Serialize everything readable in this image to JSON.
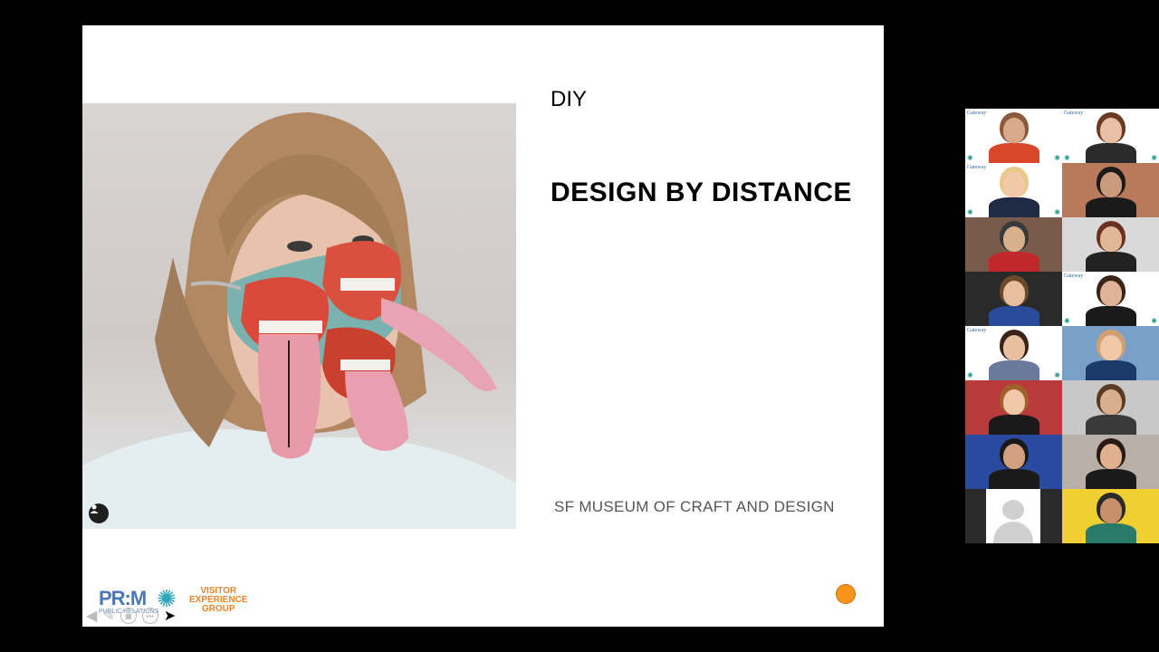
{
  "slide": {
    "heading_small": "DIY",
    "heading_main": "DESIGN BY DISTANCE",
    "credit": "SF MUSEUM OF CRAFT AND DESIGN",
    "logo": {
      "prm": "PR:M",
      "prm_sub": "PUBLIC RELATIONS",
      "veg_line1": "VISITOR",
      "veg_line2": "EXPERIENCE",
      "veg_line3": "GROUP"
    },
    "photo_alt": "person wearing knitted mask with tongues",
    "accent_color": "#f7941d"
  },
  "toolbar": {
    "back_icon": "arrow-left-icon",
    "pen_icon": "pen-icon",
    "slides_icon": "grid-icon",
    "more_icon": "more-icon",
    "pointer_icon": "pointer-icon"
  },
  "gallery": {
    "tiles": [
      {
        "brand": "Gateway",
        "bg": "#ffffff",
        "skin": "#d9a98c",
        "shirt": "#d9472b",
        "hair": "#8b5a3c"
      },
      {
        "brand": "Gateway",
        "bg": "#ffffff",
        "skin": "#e8c0a8",
        "shirt": "#2b2b2b",
        "hair": "#6a3b22"
      },
      {
        "brand": "Gateway",
        "bg": "#ffffff",
        "skin": "#f0c8aa",
        "shirt": "#1f2a44",
        "hair": "#e8c98a"
      },
      {
        "brand": "",
        "bg": "#b87a5a",
        "skin": "#c99a7c",
        "shirt": "#1a1a1a",
        "hair": "#1a1a1a"
      },
      {
        "brand": "",
        "bg": "#7a5a4a",
        "skin": "#d9b08c",
        "shirt": "#c0282a",
        "hair": "#3a3a3a"
      },
      {
        "brand": "",
        "bg": "#d9d9d9",
        "skin": "#e0b898",
        "shirt": "#222222",
        "hair": "#6a3020"
      },
      {
        "brand": "",
        "bg": "#2a2a2a",
        "skin": "#e8bfa0",
        "shirt": "#2a4a9a",
        "hair": "#6a4a2a"
      },
      {
        "brand": "Gateway",
        "bg": "#ffffff",
        "skin": "#e0b298",
        "shirt": "#1a1a1a",
        "hair": "#3a2418"
      },
      {
        "brand": "Gateway",
        "bg": "#ffffff",
        "skin": "#e6c0a0",
        "shirt": "#6a7a9a",
        "hair": "#3a2418"
      },
      {
        "brand": "",
        "bg": "#7aa0c8",
        "skin": "#f0c8aa",
        "shirt": "#1a3a6a",
        "hair": "#d0a070"
      },
      {
        "brand": "",
        "bg": "#b83a3a",
        "skin": "#f0c8aa",
        "shirt": "#1a1a1a",
        "hair": "#a0602a"
      },
      {
        "brand": "",
        "bg": "#c8c8c8",
        "skin": "#d8b090",
        "shirt": "#3a3a3a",
        "hair": "#5a3a20"
      },
      {
        "brand": "",
        "bg": "#2a4aa0",
        "skin": "#d0a080",
        "shirt": "#1a1a1a",
        "hair": "#1a1a1a"
      },
      {
        "brand": "",
        "bg": "#b8b0a8",
        "skin": "#e0b090",
        "shirt": "#1a1a1a",
        "hair": "#2a1a14"
      },
      {
        "brand": "",
        "bg": "#2a2a2a",
        "skin": "#d8d8d8",
        "shirt": "#d8d8d8",
        "hair": "#d8d8d8"
      },
      {
        "brand": "",
        "bg": "#f0d030",
        "skin": "#c8906a",
        "shirt": "#2a7a6a",
        "hair": "#2a2a2a"
      }
    ]
  }
}
